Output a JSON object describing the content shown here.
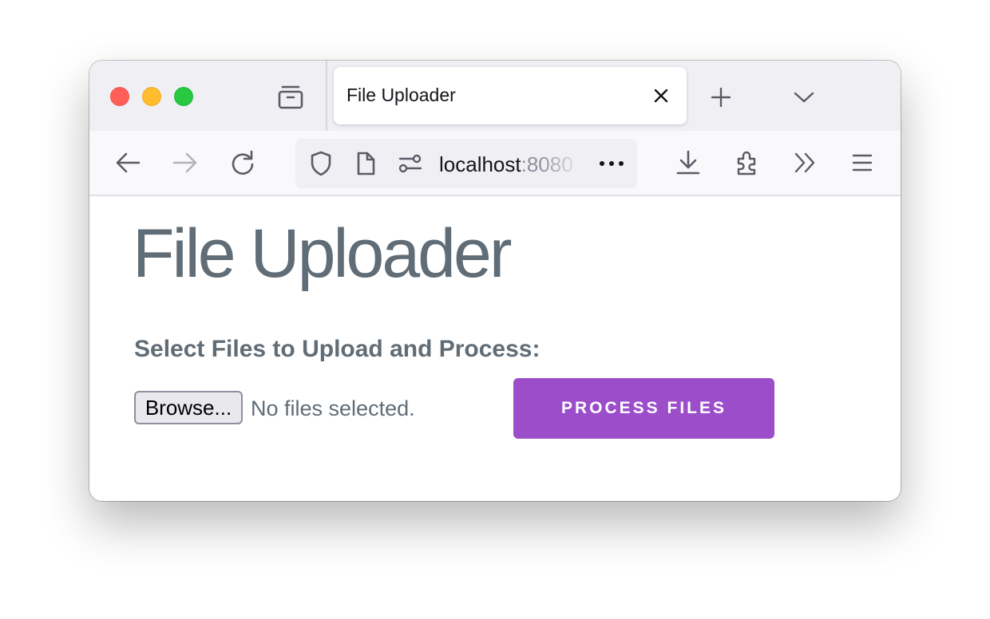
{
  "browser": {
    "tab": {
      "title": "File Uploader"
    },
    "url": {
      "host": "localhost",
      "port": ":8080"
    }
  },
  "page": {
    "heading": "File Uploader",
    "upload_label": "Select Files to Upload and Process:",
    "browse_label": "Browse...",
    "file_status": "No files selected.",
    "process_label": "PROCESS FILES"
  },
  "colors": {
    "accent": "#9b4dca",
    "text": "#606c76"
  }
}
